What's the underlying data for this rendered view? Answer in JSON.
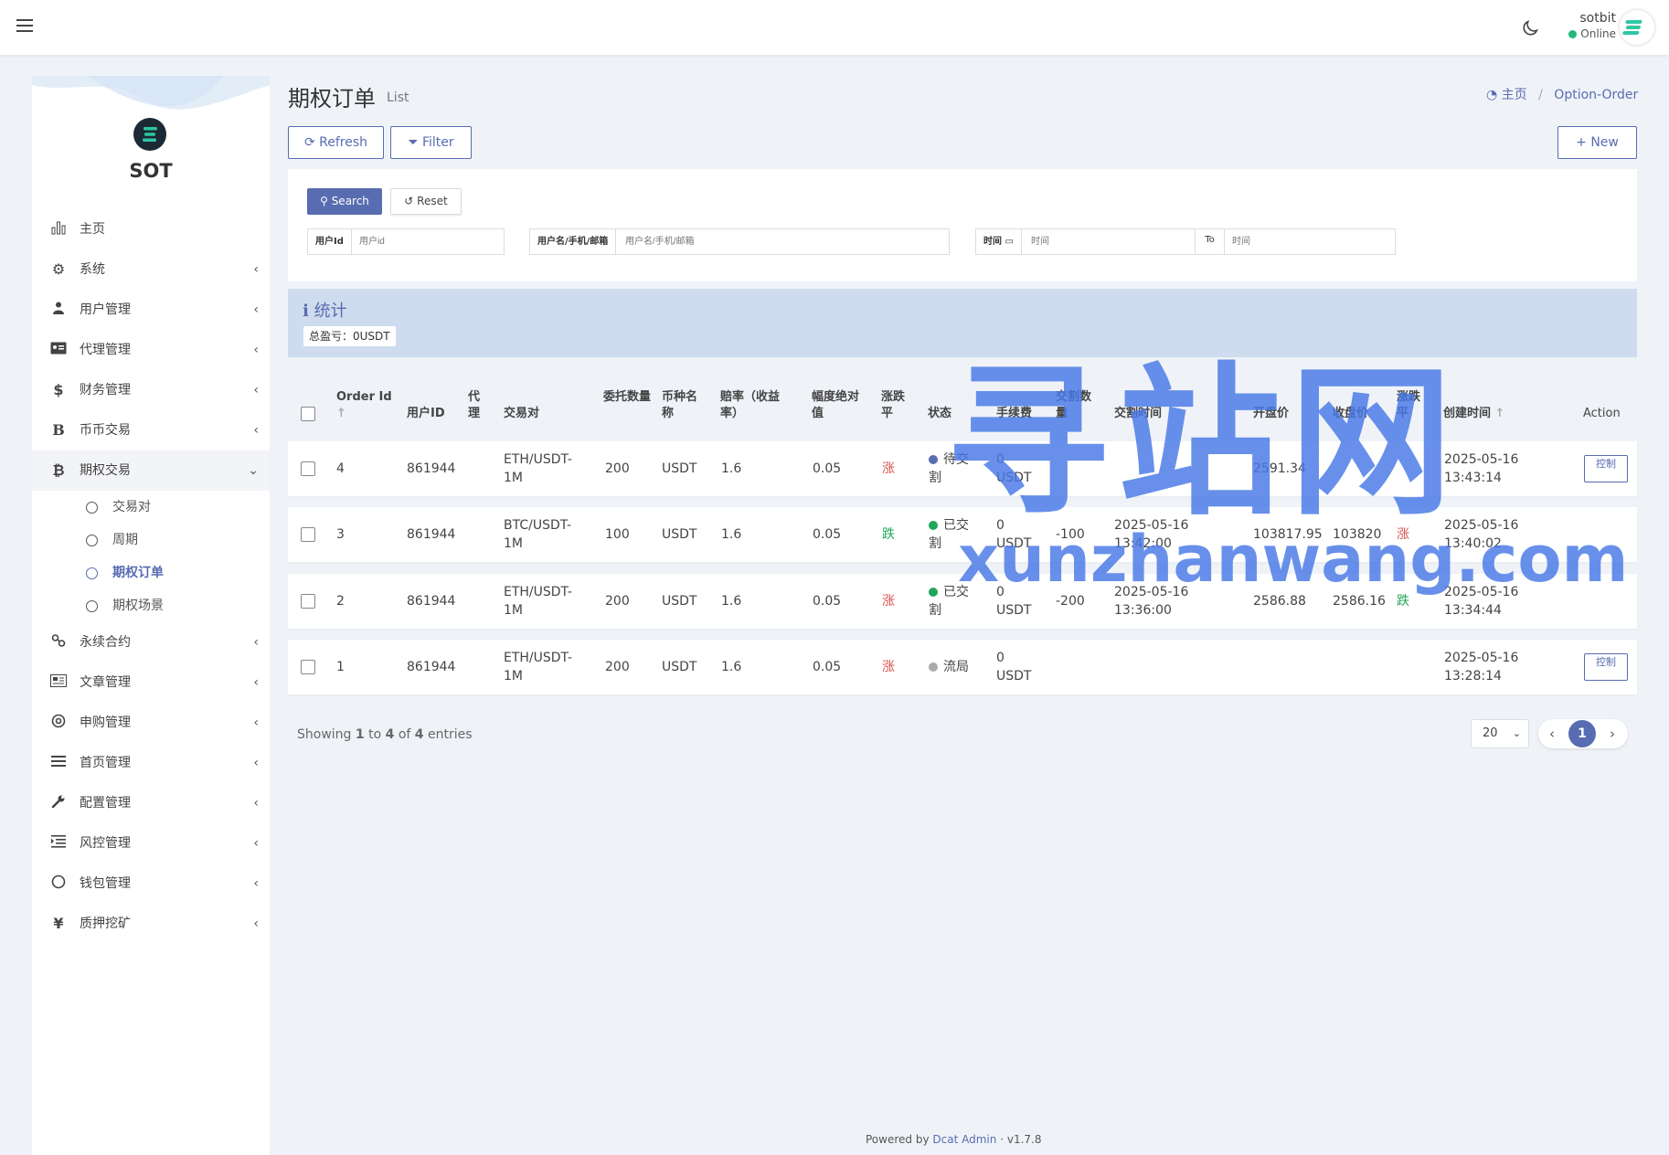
{
  "navbar": {
    "user_name": "sotbit",
    "user_status": "Online",
    "theme_icon": "moon-icon",
    "menu_icon": "hamburger-icon"
  },
  "sidebar": {
    "brand": "SOT",
    "items": [
      {
        "label": "主页",
        "icon": "bar-chart-icon",
        "has_children": false
      },
      {
        "label": "系统",
        "icon": "gear-icon",
        "has_children": true
      },
      {
        "label": "用户管理",
        "icon": "users-icon",
        "has_children": true
      },
      {
        "label": "代理管理",
        "icon": "id-card-icon",
        "has_children": true
      },
      {
        "label": "财务管理",
        "icon": "dollar-icon",
        "has_children": true
      },
      {
        "label": "币币交易",
        "icon": "b-letter-icon",
        "has_children": true
      },
      {
        "label": "期权交易",
        "icon": "bitcoin-icon",
        "has_children": true,
        "open": true
      },
      {
        "label": "永续合约",
        "icon": "link-icon",
        "has_children": true
      },
      {
        "label": "文章管理",
        "icon": "newspaper-icon",
        "has_children": true
      },
      {
        "label": "申购管理",
        "icon": "lifebuoy-icon",
        "has_children": true
      },
      {
        "label": "首页管理",
        "icon": "list-icon",
        "has_children": true
      },
      {
        "label": "配置管理",
        "icon": "wrench-icon",
        "has_children": true
      },
      {
        "label": "风控管理",
        "icon": "indent-icon",
        "has_children": true
      },
      {
        "label": "钱包管理",
        "icon": "circle-icon",
        "has_children": true
      },
      {
        "label": "质押挖矿",
        "icon": "yen-icon",
        "has_children": true
      }
    ],
    "subitems": [
      {
        "label": "交易对",
        "active": false
      },
      {
        "label": "周期",
        "active": false
      },
      {
        "label": "期权订单",
        "active": true
      },
      {
        "label": "期权场景",
        "active": false
      }
    ]
  },
  "header": {
    "title": "期权订单",
    "subtitle": "List",
    "breadcrumb_home": "主页",
    "breadcrumb_current": "Option-Order"
  },
  "toolbar": {
    "refresh": "Refresh",
    "filter": "Filter",
    "new": "New"
  },
  "search": {
    "search_btn": "Search",
    "reset_btn": "Reset",
    "user_id_label": "用户Id",
    "user_id_placeholder": "用户id",
    "user_name_label": "用户名/手机/邮箱",
    "user_name_placeholder": "用户名/手机/邮箱",
    "time_label": "时间",
    "time_start_placeholder": "时间",
    "time_to": "To",
    "time_end_placeholder": "时间"
  },
  "stats": {
    "title": "统计",
    "total_label": "总盈亏：0USDT"
  },
  "table": {
    "headers": {
      "order_id": "Order Id",
      "user_id": "用户ID",
      "agent": "代理",
      "pair": "交易对",
      "amount": "委托数量",
      "coin": "币种名称",
      "odds": "赔率（收益率）",
      "range": "幅度绝对值",
      "direction": "涨跌平",
      "status": "状态",
      "fee": "手续费",
      "settle_amount": "交割数量",
      "settle_time": "交割时间",
      "open_price": "开盘价",
      "close_price": "收盘价",
      "result": "涨跌平",
      "created_at": "创建时间",
      "action": "Action"
    },
    "rows": [
      {
        "order_id": "4",
        "user_id": "861944",
        "pair_a": "ETH/USDT-",
        "pair_b": "1M",
        "amount": "200",
        "coin": "USDT",
        "odds": "1.6",
        "range": "0.05",
        "direction": "涨",
        "status_a": "待交",
        "status_b": "割",
        "status_color": "#586cb1",
        "fee_a": "0",
        "fee_b": "USDT",
        "settle_amount": "",
        "settle_time_a": "",
        "settle_time_b": "",
        "open_price": "2591.34",
        "close_price": "",
        "result": "",
        "created_a": "2025-05-16",
        "created_b": "13:43:14",
        "action": "控制"
      },
      {
        "order_id": "3",
        "user_id": "861944",
        "pair_a": "BTC/USDT-",
        "pair_b": "1M",
        "amount": "100",
        "coin": "USDT",
        "odds": "1.6",
        "range": "0.05",
        "direction": "跌",
        "status_a": "已交",
        "status_b": "割",
        "status_color": "#21a65a",
        "fee_a": "0",
        "fee_b": "USDT",
        "settle_amount": "-100",
        "settle_time_a": "2025-05-16",
        "settle_time_b": "13:42:00",
        "open_price": "103817.95",
        "close_price": "103820",
        "result": "涨",
        "created_a": "2025-05-16",
        "created_b": "13:40:02",
        "action": ""
      },
      {
        "order_id": "2",
        "user_id": "861944",
        "pair_a": "ETH/USDT-",
        "pair_b": "1M",
        "amount": "200",
        "coin": "USDT",
        "odds": "1.6",
        "range": "0.05",
        "direction": "涨",
        "status_a": "已交",
        "status_b": "割",
        "status_color": "#21a65a",
        "fee_a": "0",
        "fee_b": "USDT",
        "settle_amount": "-200",
        "settle_time_a": "2025-05-16",
        "settle_time_b": "13:36:00",
        "open_price": "2586.88",
        "close_price": "2586.16",
        "result": "跌",
        "created_a": "2025-05-16",
        "created_b": "13:34:44",
        "action": ""
      },
      {
        "order_id": "1",
        "user_id": "861944",
        "pair_a": "ETH/USDT-",
        "pair_b": "1M",
        "amount": "200",
        "coin": "USDT",
        "odds": "1.6",
        "range": "0.05",
        "direction": "涨",
        "status_a": "流局",
        "status_b": "",
        "status_color": "#aaaaaa",
        "fee_a": "0",
        "fee_b": "USDT",
        "settle_amount": "",
        "settle_time_a": "",
        "settle_time_b": "",
        "open_price": "",
        "close_price": "",
        "result": "",
        "created_a": "2025-05-16",
        "created_b": "13:28:14",
        "action": "控制"
      }
    ]
  },
  "pagination": {
    "showing_prefix": "Showing",
    "from": "1",
    "to_word": "to",
    "to": "4",
    "of_word": "of",
    "total": "4",
    "entries_word": "entries",
    "page_size": "20",
    "current_page": "1"
  },
  "footer": {
    "prefix": "Powered by",
    "link": "Dcat Admin",
    "sep": "·",
    "version": "v1.7.8"
  },
  "watermark": {
    "cn": "寻站网",
    "en": "xunzhanwang.com"
  },
  "colors": {
    "primary": "#586cb1",
    "up": "#d9534f",
    "down": "#21a65a",
    "stats_bg": "#cfdcef"
  }
}
